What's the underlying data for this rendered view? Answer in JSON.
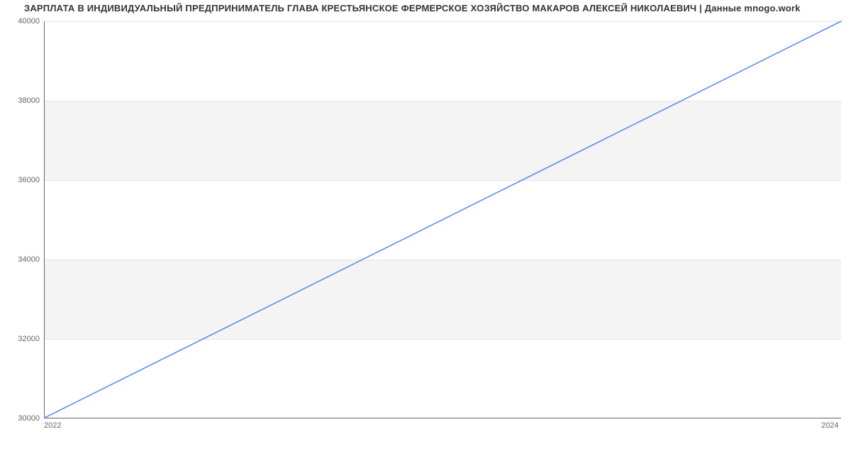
{
  "chart_data": {
    "type": "line",
    "title": "ЗАРПЛАТА В ИНДИВИДУАЛЬНЫЙ ПРЕДПРИНИМАТЕЛЬ ГЛАВА КРЕСТЬЯНСКОЕ ФЕРМЕРСКОЕ ХОЗЯЙСТВО МАКАРОВ АЛЕКСЕЙ НИКОЛАЕВИЧ | Данные mnogo.work",
    "x": [
      2022,
      2024
    ],
    "values": [
      30000,
      40000
    ],
    "xlabel": "",
    "ylabel": "",
    "xlim": [
      2022,
      2024
    ],
    "ylim": [
      30000,
      40000
    ],
    "x_ticks": [
      2022,
      2024
    ],
    "y_ticks": [
      30000,
      32000,
      34000,
      36000,
      38000,
      40000
    ],
    "line_color": "#5b8def"
  }
}
